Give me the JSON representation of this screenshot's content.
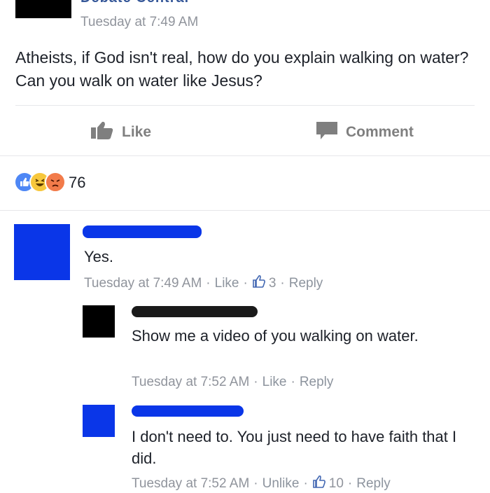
{
  "post": {
    "page_name": "Debate Central",
    "timestamp": "Tuesday at 7:49 AM",
    "text": "Atheists, if God isn't real, how do you explain walking on water? Can you walk on water like Jesus?"
  },
  "actions": {
    "like_label": "Like",
    "comment_label": "Comment"
  },
  "reactions": {
    "count": "76",
    "icons": [
      "like-icon",
      "haha-icon",
      "angry-icon"
    ]
  },
  "comments": [
    {
      "text": "Yes.",
      "time": "Tuesday at 7:49 AM",
      "like": "Like",
      "likes": "3",
      "reply": "Reply"
    },
    {
      "text": "Show me a video of you walking on water.",
      "time": "Tuesday at 7:52 AM",
      "like": "Like",
      "reply": "Reply"
    },
    {
      "text": "I don't need to. You just need to have faith that I did.",
      "time": "Tuesday at 7:52 AM",
      "like": "Unlike",
      "likes": "10",
      "reply": "Reply"
    }
  ],
  "colors": {
    "redact_blue": "#0a36e8",
    "meta_gray": "#90949c",
    "like_blue": "#4267b2"
  }
}
